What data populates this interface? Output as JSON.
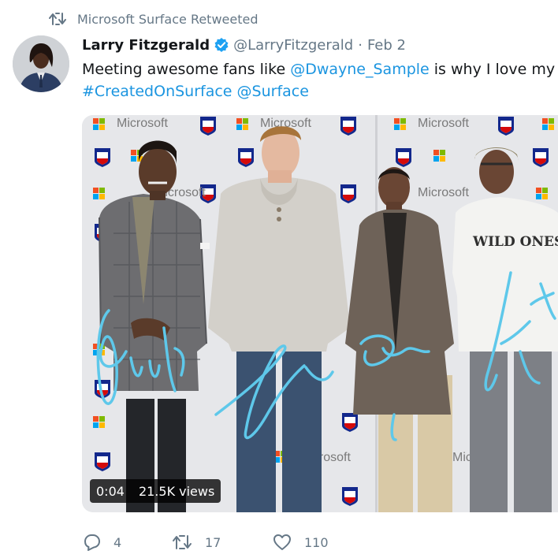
{
  "retweet_context": {
    "icon": "retweet-icon",
    "text": "Microsoft Surface Retweeted"
  },
  "tweet": {
    "author_name": "Larry Fitzgerald",
    "verified": true,
    "handle": "@LarryFitzgerald",
    "separator": "·",
    "date": "Feb 2",
    "text_line1": {
      "prefix": "Meeting awesome fans like ",
      "mention": "@Dwayne_Sample",
      "suffix": " is why I love my jol"
    },
    "text_line2": {
      "hashtag": "#CreatedOnSurface",
      "space": " ",
      "mention": "@Surface"
    }
  },
  "media": {
    "type": "video",
    "duration": "0:04",
    "views": "21.5K views",
    "backdrop_logos": {
      "microsoft": "Microsoft",
      "nfl": "NFL"
    },
    "shirt_text": "WILD ONES"
  },
  "actions": {
    "reply_count": "4",
    "retweet_count": "17",
    "like_count": "110"
  },
  "colors": {
    "link": "#1b95e0",
    "secondary_text": "#657786",
    "verified": "#1da1f2",
    "signature": "#5ec8ea"
  }
}
